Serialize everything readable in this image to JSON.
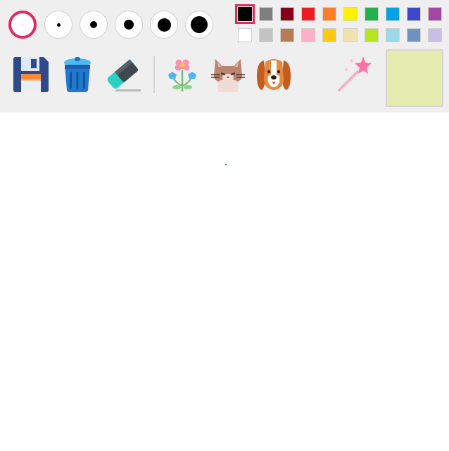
{
  "toolbar": {
    "brush_sizes": [
      {
        "size": 1,
        "selected": true
      },
      {
        "size": 4,
        "selected": false
      },
      {
        "size": 9,
        "selected": false
      },
      {
        "size": 14,
        "selected": false
      },
      {
        "size": 19,
        "selected": false
      },
      {
        "size": 24,
        "selected": false
      }
    ],
    "palette_row1": [
      "#000000",
      "#7f7f7f",
      "#880015",
      "#ed1c24",
      "#ff7f27",
      "#fff200",
      "#22b14c",
      "#00a2e8",
      "#3f48cc",
      "#a349a4"
    ],
    "palette_row2": [
      "#ffffff",
      "#c3c3c3",
      "#b97a57",
      "#ffaec9",
      "#ffc90e",
      "#efe4b0",
      "#b5e61d",
      "#99d9ea",
      "#7092be",
      "#c8bfe7"
    ],
    "selected_color": "#000000",
    "preview_color": "#e4ecb0",
    "tools": [
      "save-icon",
      "trash-icon",
      "eraser-icon"
    ],
    "stickers": [
      "flower-icon",
      "cat-icon",
      "dog-icon"
    ],
    "magic": "magic-wand-icon"
  },
  "canvas": {
    "background": "#ffffff"
  }
}
